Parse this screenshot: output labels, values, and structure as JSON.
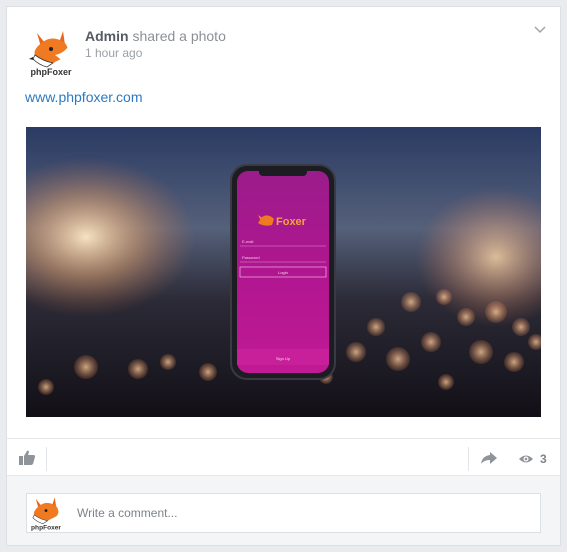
{
  "post": {
    "author": "Admin",
    "action": "shared a photo",
    "time": "1 hour ago",
    "link_text": "www.phpfoxer.com",
    "avatar_brand": "phpFoxer"
  },
  "photo": {
    "app_name": "Foxer",
    "email_label": "E-mail",
    "password_label": "Password",
    "login_label": "Login",
    "signup_label": "Sign Up"
  },
  "actions": {
    "views_count": "3"
  },
  "comment": {
    "placeholder": "Write a comment...",
    "avatar_brand": "phpFoxer"
  },
  "colors": {
    "link": "#2c79c1",
    "phone_screen": "#b0168f",
    "card_bg": "#ffffff"
  },
  "icons": [
    "fox-avatar-icon",
    "chevron-down-icon",
    "thumbs-up-icon",
    "share-arrow-icon",
    "eye-icon"
  ]
}
